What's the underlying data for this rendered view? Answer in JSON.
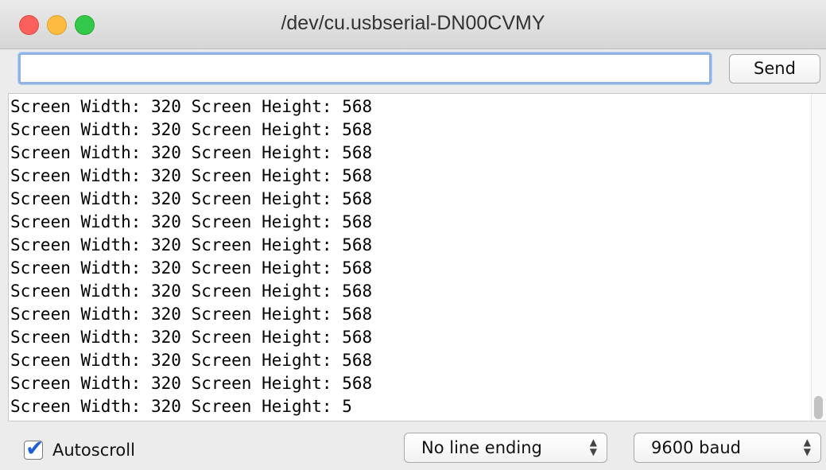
{
  "window": {
    "title": "/dev/cu.usbserial-DN00CVMY"
  },
  "input": {
    "value": "",
    "placeholder": ""
  },
  "send_button": {
    "label": "Send"
  },
  "output": {
    "lines": [
      "Screen Width: 320 Screen Height: 568",
      "Screen Width: 320 Screen Height: 568",
      "Screen Width: 320 Screen Height: 568",
      "Screen Width: 320 Screen Height: 568",
      "Screen Width: 320 Screen Height: 568",
      "Screen Width: 320 Screen Height: 568",
      "Screen Width: 320 Screen Height: 568",
      "Screen Width: 320 Screen Height: 568",
      "Screen Width: 320 Screen Height: 568",
      "Screen Width: 320 Screen Height: 568",
      "Screen Width: 320 Screen Height: 568",
      "Screen Width: 320 Screen Height: 568",
      "Screen Width: 320 Screen Height: 568",
      "Screen Width: 320 Screen Height: 5"
    ]
  },
  "footer": {
    "autoscroll_label": "Autoscroll",
    "autoscroll_checked": true,
    "line_ending": "No line ending",
    "baud": "9600 baud"
  },
  "colors": {
    "close": "#fc605c",
    "minimize": "#fdbc40",
    "maximize": "#34c84a",
    "focus_ring": "#8fb4e3",
    "checkmark": "#1f5fd6"
  }
}
